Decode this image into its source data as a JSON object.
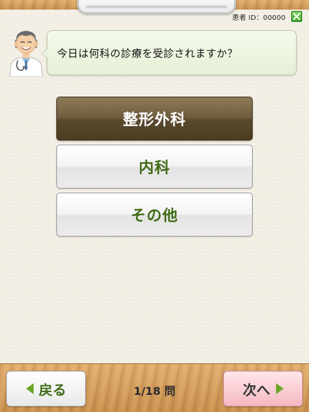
{
  "header": {
    "patient_id_label": "患者 ID：00000"
  },
  "question": {
    "text": "今日は何科の診療を受診されますか？"
  },
  "options": [
    {
      "label": "整形外科",
      "selected": true
    },
    {
      "label": "内科",
      "selected": false
    },
    {
      "label": "その他",
      "selected": false
    }
  ],
  "footer": {
    "back_label": "戻る",
    "next_label": "次へ",
    "page_indicator": "1/18 問"
  },
  "colors": {
    "accent_green": "#3f6b16",
    "selected_brown": "#5a4a2e",
    "next_pink": "#f5b8c2"
  },
  "icons": {
    "close": "close-icon",
    "back_arrow": "triangle-left-icon",
    "next_arrow": "triangle-right-icon"
  }
}
